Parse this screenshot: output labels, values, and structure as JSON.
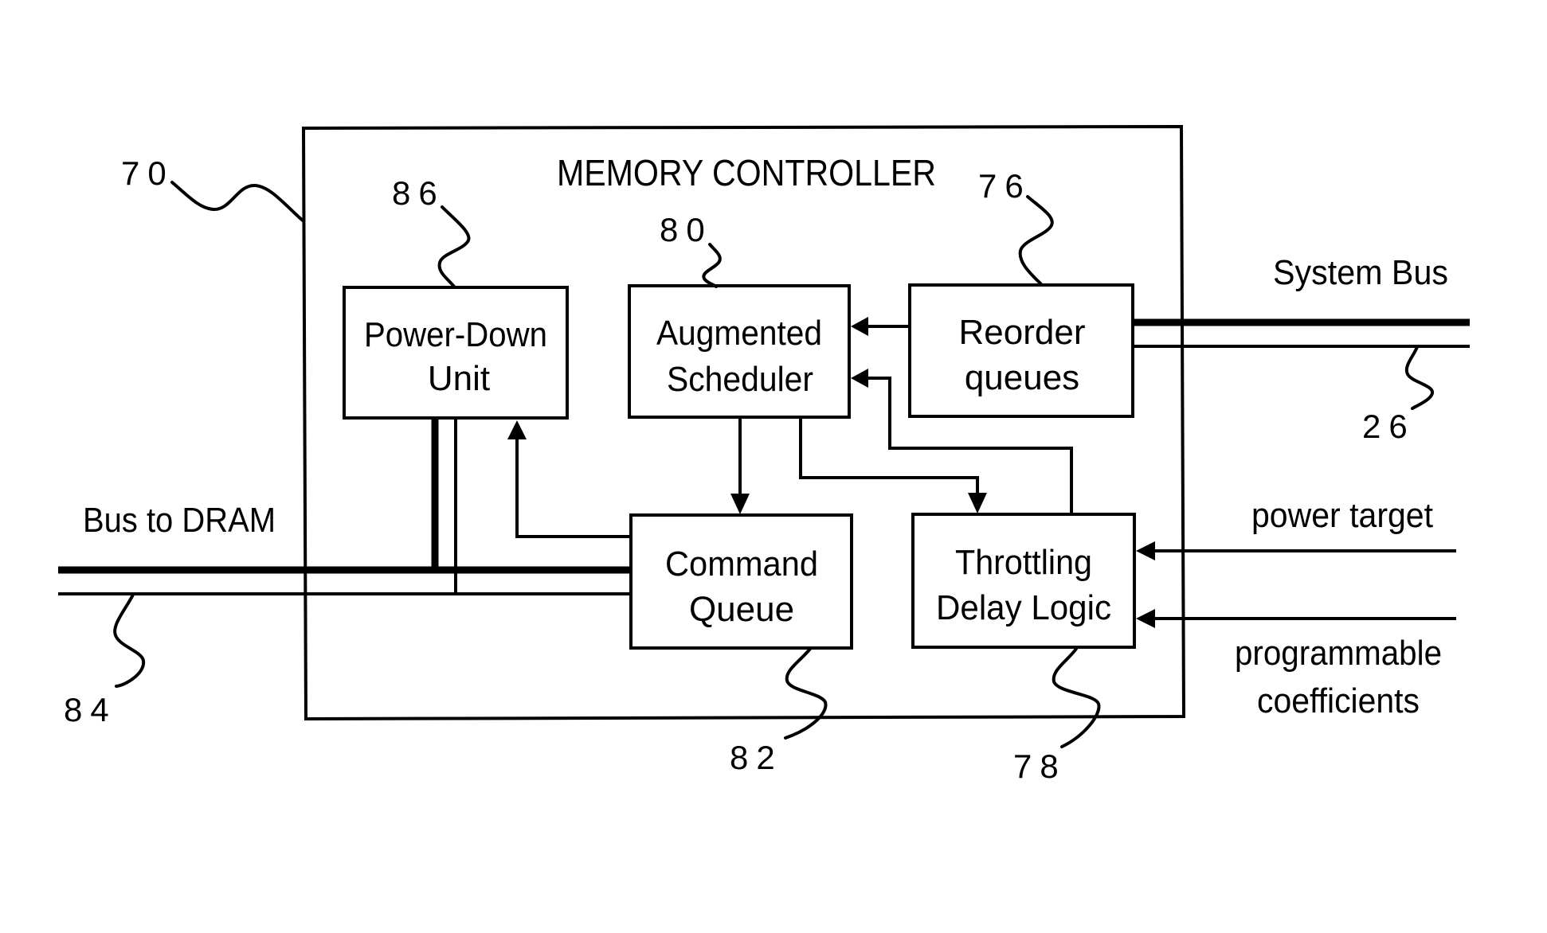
{
  "title": "MEMORY CONTROLLER",
  "blocks": {
    "power_down": {
      "ref": "86",
      "line1": "Power-Down",
      "line2": "Unit"
    },
    "scheduler": {
      "ref": "80",
      "line1": "Augmented",
      "line2": "Scheduler"
    },
    "reorder": {
      "ref": "76",
      "line1": "Reorder",
      "line2": "queues"
    },
    "command_queue": {
      "ref": "82",
      "line1": "Command",
      "line2": "Queue"
    },
    "throttling": {
      "ref": "78",
      "line1": "Throttling",
      "line2": "Delay Logic"
    }
  },
  "controller_ref": "70",
  "external": {
    "system_bus": {
      "label": "System Bus",
      "ref": "26"
    },
    "dram_bus": {
      "label": "Bus to DRAM",
      "ref": "84"
    },
    "power_target": {
      "label": "power target"
    },
    "coefficients": {
      "line1": "programmable",
      "line2": "coefficients"
    }
  }
}
